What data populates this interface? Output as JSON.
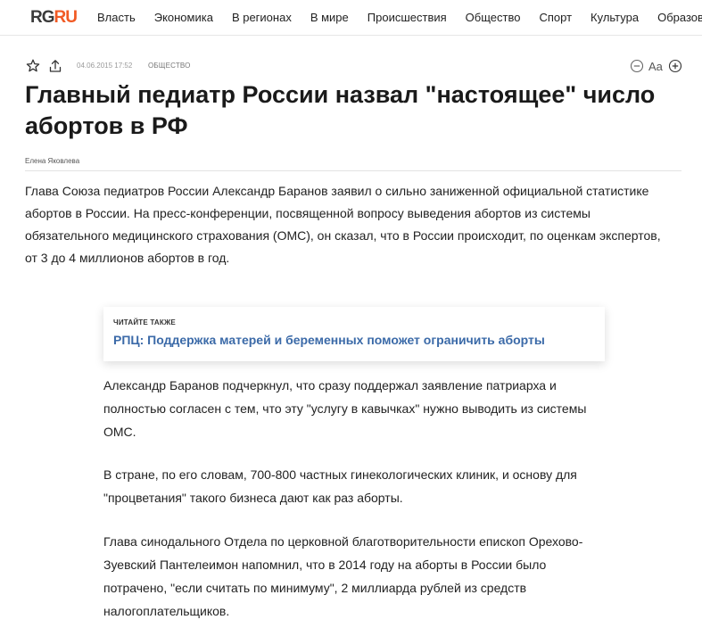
{
  "header": {
    "logo_rg": "RG",
    "logo_ru": "RU",
    "nav": [
      "Власть",
      "Экономика",
      "В регионах",
      "В мире",
      "Происшествия",
      "Общество",
      "Спорт",
      "Культура",
      "Образование"
    ]
  },
  "article": {
    "date": "04.06.2015 17:52",
    "rubric": "ОБЩЕСТВО",
    "font_size_label": "Aa",
    "title": "Главный педиатр России назвал \"настоящее\" число абортов в РФ",
    "author": "Елена Яковлева",
    "lead": "Глава Союза педиатров России Александр Баранов заявил о сильно заниженной официальной статистике абортов в России. На пресс-конференции, посвященной вопросу выведения абортов из системы обязательного медицинского страхования (ОМС), он сказал, что в России происходит, по оценкам экспертов, от 3 до 4 миллионов абортов в год.",
    "read_also": {
      "label": "ЧИТАЙТЕ ТАКЖЕ",
      "link": "РПЦ: Поддержка матерей и беременных поможет ограничить аборты"
    },
    "paragraphs": [
      "Александр Баранов подчеркнул, что сразу поддержал заявление патриарха и полностью согласен с  тем, что эту \"услугу в кавычках\" нужно выводить из системы ОМС.",
      "В стране, по его словам, 700-800 частных гинекологических клиник, и основу для \"процветания\" такого бизнеса дают как раз аборты.",
      "Глава синодального Отдела по церковной благотворительности епископ Орехово-Зуевский Пантелеимон напомнил, что в 2014 году на аборты в России было потрачено, \"если считать по минимуму\", 2 миллиарда рублей из средств налогоплательщиков."
    ]
  },
  "colors": {
    "accent_logo": "#f15a24",
    "link": "#3b6aa8"
  }
}
